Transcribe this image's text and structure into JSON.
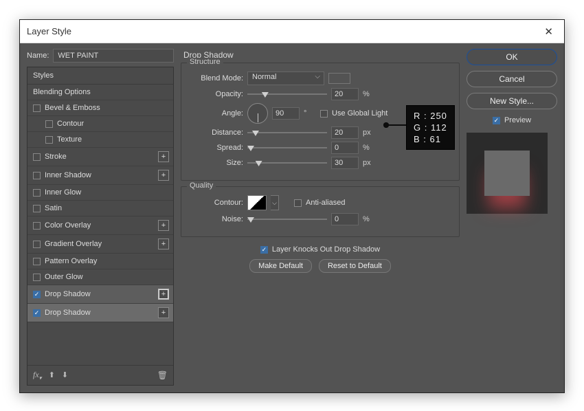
{
  "dialog": {
    "title": "Layer Style"
  },
  "name": {
    "label": "Name:",
    "value": "WET PAINT"
  },
  "stylesPanel": {
    "header": "Styles",
    "blending": "Blending Options",
    "items": {
      "bevel": "Bevel & Emboss",
      "contour": "Contour",
      "texture": "Texture",
      "stroke": "Stroke",
      "innerShadow": "Inner Shadow",
      "innerGlow": "Inner Glow",
      "satin": "Satin",
      "colorOverlay": "Color Overlay",
      "gradientOverlay": "Gradient Overlay",
      "patternOverlay": "Pattern Overlay",
      "outerGlow": "Outer Glow",
      "dropShadow1": "Drop Shadow",
      "dropShadow2": "Drop Shadow"
    }
  },
  "panel": {
    "title": "Drop Shadow",
    "structure": "Structure",
    "blendModeLabel": "Blend Mode:",
    "blendModeValue": "Normal",
    "swatchColor": "#fa7a3a",
    "opacityLabel": "Opacity:",
    "opacityValue": "20",
    "pct": "%",
    "angleLabel": "Angle:",
    "angleValue": "90",
    "deg": "°",
    "useGlobal": "Use Global Light",
    "distanceLabel": "Distance:",
    "distanceValue": "20",
    "px": "px",
    "spreadLabel": "Spread:",
    "spreadValue": "0",
    "sizeLabel": "Size:",
    "sizeValue": "30",
    "quality": "Quality",
    "contourLabel": "Contour:",
    "antiAliased": "Anti-aliased",
    "noiseLabel": "Noise:",
    "noiseValue": "0",
    "knocks": "Layer Knocks Out Drop Shadow",
    "makeDefault": "Make Default",
    "resetDefault": "Reset to Default"
  },
  "buttons": {
    "ok": "OK",
    "cancel": "Cancel",
    "newStyle": "New Style...",
    "preview": "Preview"
  },
  "rgb": {
    "r": "R : 250",
    "g": "G : 112",
    "b": "B : 61"
  }
}
